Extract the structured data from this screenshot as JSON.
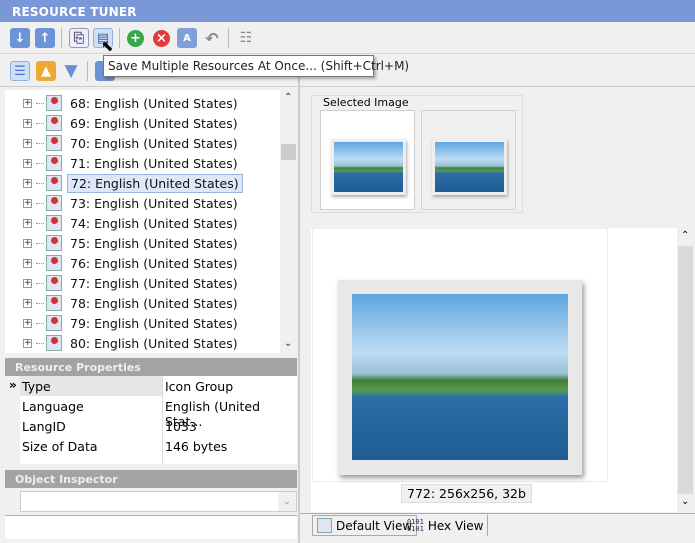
{
  "app": {
    "title": "RESOURCE TUNER"
  },
  "toolbar": {
    "tooltip": "Save Multiple Resources At Once... (Shift+Ctrl+M)"
  },
  "tree": {
    "items": [
      "68: English (United States)",
      "69: English (United States)",
      "70: English (United States)",
      "71: English (United States)",
      "72: English (United States)",
      "73: English (United States)",
      "74: English (United States)",
      "75: English (United States)",
      "76: English (United States)",
      "77: English (United States)",
      "78: English (United States)",
      "79: English (United States)",
      "80: English (United States)"
    ],
    "selected_index": 4
  },
  "properties": {
    "title": "Resource Properties",
    "rows": [
      {
        "name": "Type",
        "value": "Icon Group"
      },
      {
        "name": "Language",
        "value": "English (United Stat..."
      },
      {
        "name": "LangID",
        "value": "1033"
      },
      {
        "name": "Size of Data",
        "value": "146 bytes"
      }
    ]
  },
  "inspector": {
    "title": "Object Inspector",
    "combo_value": ""
  },
  "viewer": {
    "group_label": "Selected Image",
    "image_caption": "772: 256x256, 32b"
  },
  "tabs": [
    "Default View",
    "Hex View"
  ],
  "colors": {
    "titlebar": "#7a97d8",
    "header": "#a3a3a3"
  }
}
